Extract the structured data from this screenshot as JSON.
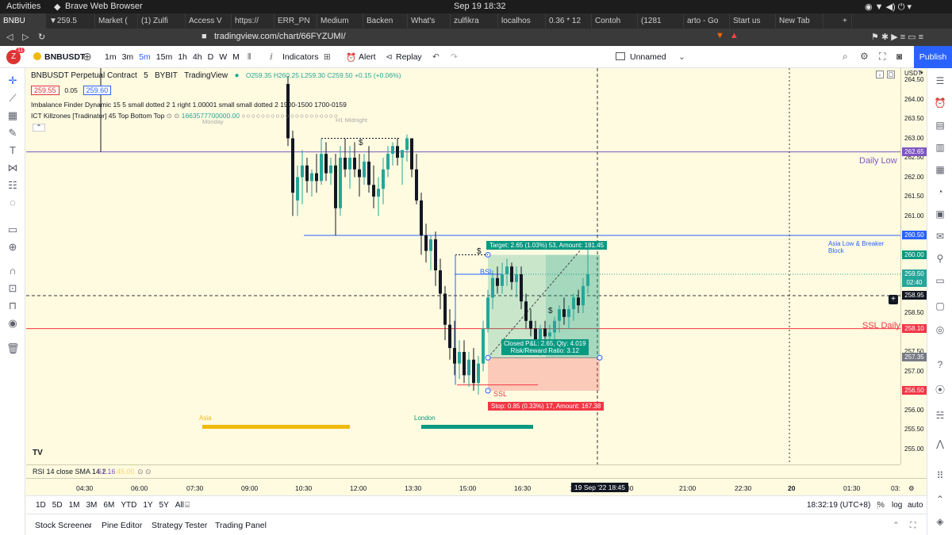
{
  "os_bar": {
    "activities": "Activities",
    "app": "Brave Web Browser",
    "clock": "Sep 19  18:32"
  },
  "browser_tabs": [
    {
      "label": "BNBU",
      "active": true
    },
    {
      "label": "▼259.5",
      "active": false
    },
    {
      "label": "Market (",
      "active": false
    },
    {
      "label": "(1) Zulfi",
      "active": false
    },
    {
      "label": "Access V",
      "active": false
    },
    {
      "label": "https://",
      "active": false
    },
    {
      "label": "ERR_PN",
      "active": false
    },
    {
      "label": "Medium",
      "active": false
    },
    {
      "label": "Backen",
      "active": false
    },
    {
      "label": "What's",
      "active": false
    },
    {
      "label": "zulfikra",
      "active": false
    },
    {
      "label": "localhos",
      "active": false
    },
    {
      "label": "0.36 * 12",
      "active": false
    },
    {
      "label": "Contoh",
      "active": false
    },
    {
      "label": "(1281",
      "active": false
    },
    {
      "label": "arto - Go",
      "active": false
    },
    {
      "label": "Start us",
      "active": false
    },
    {
      "label": "New Tab",
      "active": false
    }
  ],
  "address": {
    "url": "tradingview.com/chart/66FYZUMI/"
  },
  "toolbar": {
    "symbol": "BNBUSDT",
    "intervals": [
      "1m",
      "3m",
      "5m",
      "15m",
      "1h",
      "4h",
      "D",
      "W",
      "M"
    ],
    "active_interval": "5m",
    "indicators": "Indicators",
    "alert": "Alert",
    "replay": "Replay",
    "layout_name": "Unnamed",
    "publish": "Publish",
    "notification_count": "11"
  },
  "legend": {
    "title": "BNBUSDT Perpetual Contract",
    "interval": "5",
    "exchange": "BYBIT",
    "source": "TradingView",
    "ohlc": "O259.35 H260.25 L259.30 C259.50 +0.15 (+0.06%)",
    "bid": "259.55",
    "spread": "0.05",
    "ask": "259.60",
    "indicator1": "Imbalance Finder Dynamic 15 5 small dotted 2 1 right 1.00001 small small dotted 2 1900-1500 1700-0159",
    "indicator2": "ICT Killzones [Tradinator] 45 Top Bottom Top",
    "indicator2_value": "1663577700000.00",
    "faded_labels": [
      "Monday",
      "H1 Midnight"
    ]
  },
  "price_scale": {
    "currency": "USDT",
    "labels": [
      "264.50",
      "264.00",
      "263.50",
      "263.00",
      "262.50",
      "262.00",
      "261.50",
      "261.00",
      "260.50",
      "260.00",
      "259.50",
      "258.95",
      "258.50",
      "258.10",
      "257.50",
      "257.35",
      "257.00",
      "256.50",
      "256.00",
      "255.50",
      "255.00"
    ],
    "badges": [
      {
        "text": "262.65",
        "color": "#7e57c2"
      },
      {
        "text": "260.50",
        "color": "#2962ff"
      },
      {
        "text": "260.00",
        "color": "#089981"
      },
      {
        "text": "259.50",
        "color": "#26a69a"
      },
      {
        "text": "02:40",
        "color": "#26a69a"
      },
      {
        "text": "258.95",
        "color": "#131722"
      },
      {
        "text": "258.10",
        "color": "#f23645"
      },
      {
        "text": "257.35",
        "color": "#787b86"
      },
      {
        "text": "256.50",
        "color": "#f23645"
      }
    ]
  },
  "annotations": {
    "daily_low": "Daily Low",
    "asia_low": "Asia Low & Breaker Block",
    "ssl_daily": "SSL Daily",
    "bsl": "BSL",
    "ssl": "SSL",
    "dollar": "$",
    "target": "Target: 2.65 (1.03%) 53, Amount: 181.45",
    "stop": "Stop: 0.85 (0.33%) 17, Amount: 167.38",
    "closed_pl": "Closed P&L: 2.65, Qty: 4.019",
    "risk_reward": "Risk/Reward Ratio: 3.12",
    "asia_session": "Asia",
    "london_session": "London"
  },
  "rsi": {
    "label": "RSI 14 close SMA 14 2",
    "value": "61.16",
    "faded": "45.00"
  },
  "time_axis": {
    "labels": [
      "04:30",
      "06:00",
      "07:30",
      "09:00",
      "10:30",
      "12:00",
      "13:30",
      "15:00",
      "16:30",
      "18",
      "19 Sep '22  18:45",
      "30",
      "21:00",
      "22:30",
      "20",
      "01:30",
      "03:"
    ]
  },
  "range_bar": {
    "ranges": [
      "1D",
      "5D",
      "1M",
      "3M",
      "6M",
      "YTD",
      "1Y",
      "5Y",
      "All"
    ],
    "clock": "18:32:19 (UTC+8)",
    "percent": "%",
    "log": "log",
    "auto": "auto"
  },
  "panels": [
    "Stock Screener",
    "Pine Editor",
    "Strategy Tester",
    "Trading Panel"
  ],
  "colors": {
    "bull": "#26a69a",
    "bear": "#131722",
    "bg": "#fffbe0",
    "accent": "#2962ff"
  }
}
